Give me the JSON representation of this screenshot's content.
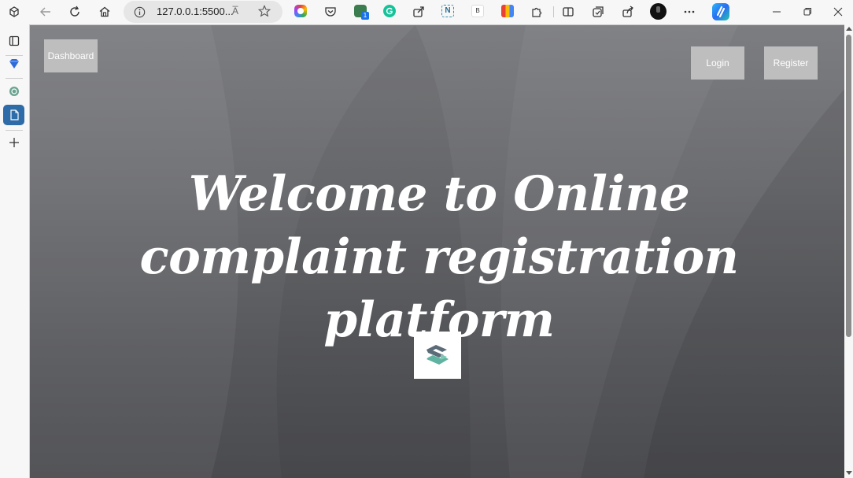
{
  "browser": {
    "url": "127.0.0.1:5500...",
    "read_aloud_label": "A̅",
    "icons": {
      "workspaces": "workspaces-icon",
      "back": "back-arrow-icon",
      "refresh": "refresh-icon",
      "home": "home-icon",
      "info": "site-info-icon",
      "favorite": "star-icon",
      "split": "split-screen-icon",
      "more": "more-dots-icon",
      "copilot": "copilot-icon"
    },
    "extension_badge": "1"
  },
  "sidebar": {
    "items": [
      "tab-actions-icon",
      "diamond-icon",
      "chatgpt-icon",
      "document-icon",
      "add-icon"
    ]
  },
  "page": {
    "nav": {
      "dashboard_label": "Dashboard",
      "login_label": "Login",
      "register_label": "Register"
    },
    "heading": "Welcome to Online complaint registration platform",
    "logo": "logo-icon"
  },
  "colors": {
    "button_bg": "#bebebe",
    "heading_color": "#ffffff",
    "logo_teal": "#5fb3a0",
    "logo_dark": "#5b6b78"
  }
}
